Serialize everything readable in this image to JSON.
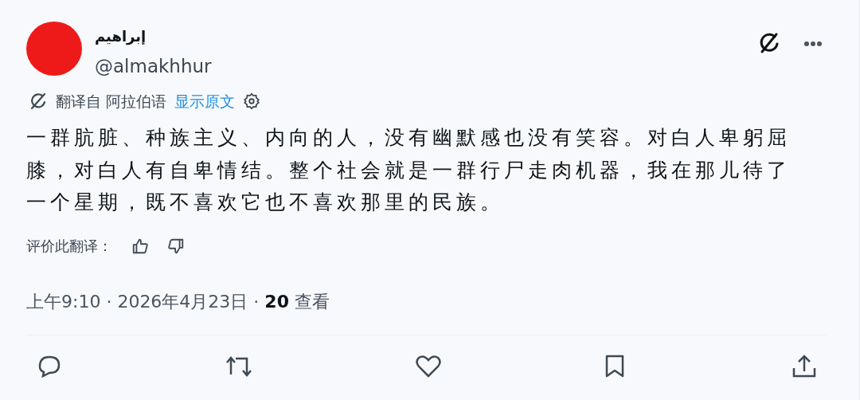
{
  "author": {
    "name": "إبراهيم",
    "handle": "@almakhhur"
  },
  "translation": {
    "label": "翻译自 阿拉伯语",
    "link": "显示原文"
  },
  "body": "一群肮脏、种族主义、内向的人，没有幽默感也没有笑容。对白人卑躬屈膝，对白人有自卑情结。整个社会就是一群行尸走肉机器，我在那儿待了一个星期，既不喜欢它也不喜欢那里的民族。",
  "rating": {
    "label": "评价此翻译："
  },
  "meta": "上午9:10 · 2026年4月23日 · **20** 查看"
}
